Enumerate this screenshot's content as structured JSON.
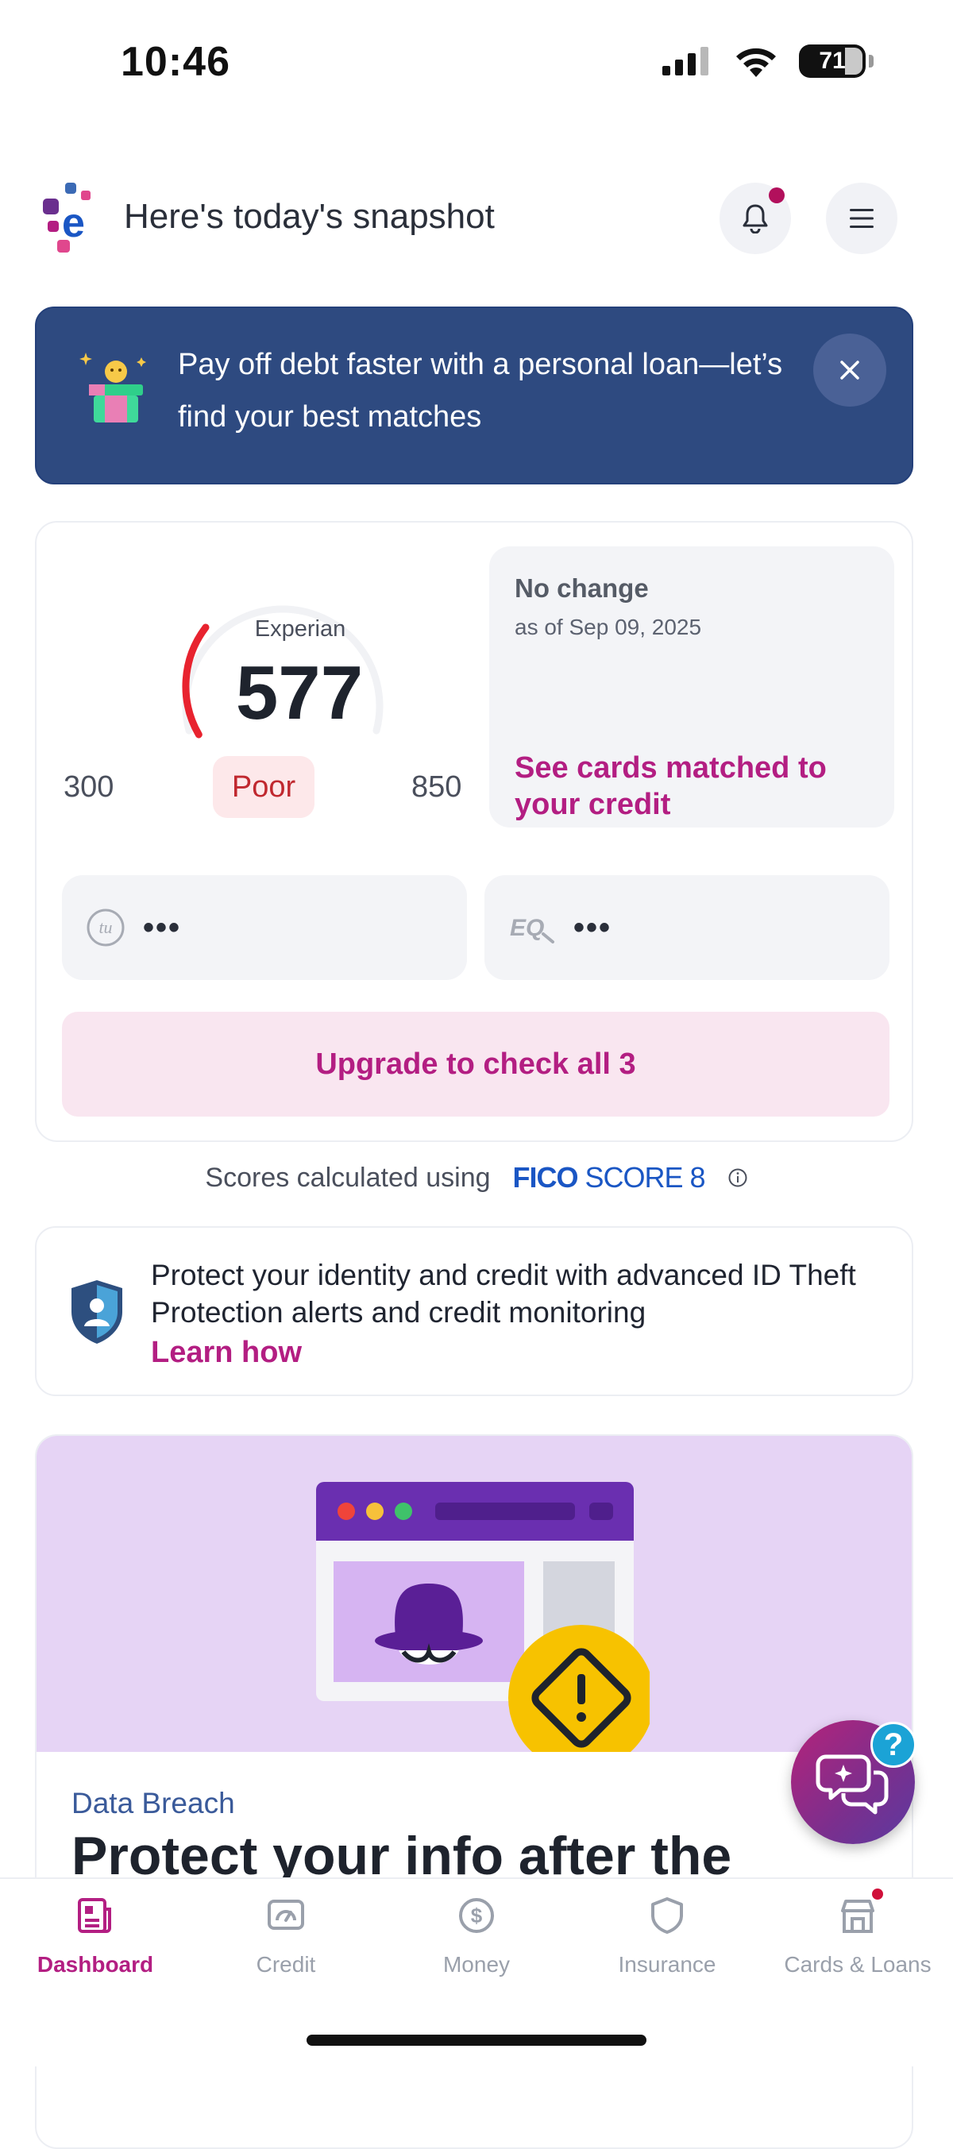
{
  "status_bar": {
    "time": "10:46",
    "battery": "71"
  },
  "header": {
    "title": "Here's today's snapshot"
  },
  "banner": {
    "text": "Pay off debt faster with a personal loan—let’s find your best matches"
  },
  "score_card": {
    "bureau": "Experian",
    "score": "577",
    "range_min": "300",
    "range_max": "850",
    "rating": "Poor",
    "score_fraction": 0.51,
    "change_title": "No change",
    "change_date": "as of Sep 09, 2025",
    "change_link": "See cards matched to your credit",
    "transunion_value": "•••",
    "equifax_value": "•••",
    "upgrade_label": "Upgrade to check all 3"
  },
  "fico": {
    "prefix": "Scores calculated using",
    "brand_bold": "FICO",
    "brand_rest": "SCORE 8"
  },
  "id_card": {
    "text": "Protect your identity and credit with advanced ID Theft Protection alerts and credit monitoring",
    "link": "Learn how"
  },
  "article": {
    "category": "Data Breach",
    "title": "Protect your info after the"
  },
  "help_badge": "?",
  "nav": {
    "items": [
      {
        "label": "Dashboard",
        "icon": "newspaper-icon"
      },
      {
        "label": "Credit",
        "icon": "speedometer-icon"
      },
      {
        "label": "Money",
        "icon": "dollar-icon"
      },
      {
        "label": "Insurance",
        "icon": "shield-icon"
      },
      {
        "label": "Cards & Loans",
        "icon": "storefront-icon"
      }
    ],
    "active": "Dashboard"
  },
  "colors": {
    "brand_magenta": "#b31e82",
    "banner_navy": "#2e4a80",
    "poor_red": "#e8232f"
  }
}
